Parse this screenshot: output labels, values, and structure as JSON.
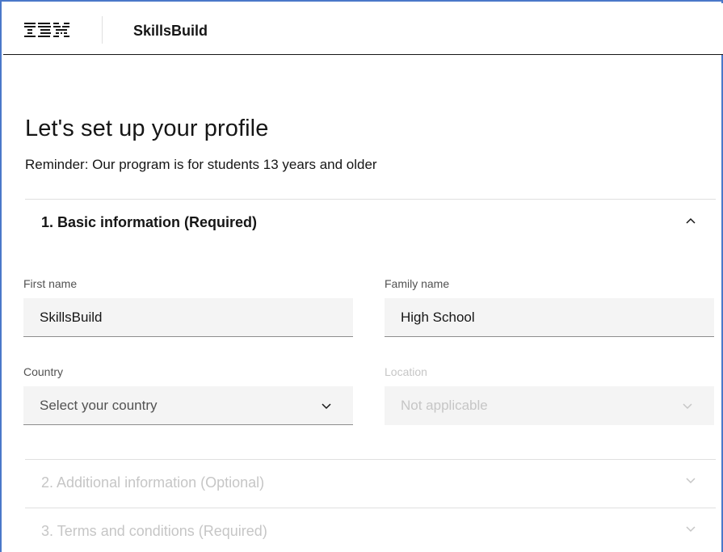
{
  "header": {
    "logo_text": "IBM",
    "brand": "SkillsBuild"
  },
  "page": {
    "title": "Let's set up your profile",
    "reminder": "Reminder: Our program is for students 13 years and older"
  },
  "sections": [
    {
      "title": "1. Basic information (Required)",
      "state": "expanded"
    },
    {
      "title": "2. Additional information (Optional)",
      "state": "collapsed"
    },
    {
      "title": "3. Terms and conditions (Required)",
      "state": "collapsed"
    }
  ],
  "form": {
    "first_name": {
      "label": "First name",
      "value": "SkillsBuild"
    },
    "family_name": {
      "label": "Family name",
      "value": "High School"
    },
    "country": {
      "label": "Country",
      "placeholder": "Select your country"
    },
    "location": {
      "label": "Location",
      "value": "Not applicable"
    }
  },
  "colors": {
    "text": "#161616",
    "muted": "#c6c6c6",
    "field_bg": "#f4f4f4",
    "frame_border": "#4a78c9"
  },
  "icons": {
    "logo": "ibm-logo",
    "expanded": "chevron-up-icon",
    "collapsed": "chevron-down-icon"
  }
}
